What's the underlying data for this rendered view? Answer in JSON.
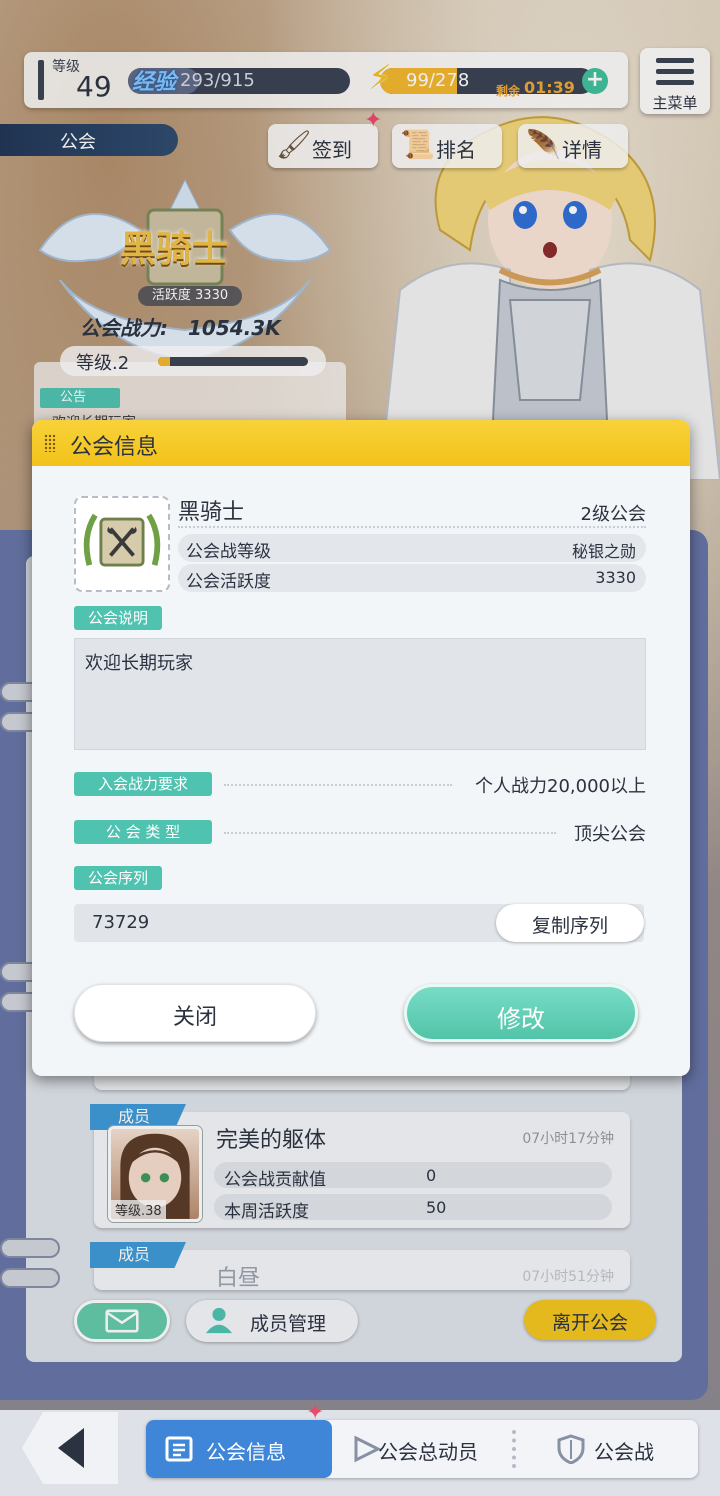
{
  "topbar": {
    "level_label": "等级",
    "level_value": "49",
    "exp_label": "经验",
    "exp_text": "293/915",
    "exp_progress": 0.32,
    "stamina_text": "99/278",
    "stamina_progress": 0.36,
    "remain_label": "剩余",
    "remain_time": "01:39",
    "menu_label": "主菜单"
  },
  "guild_header": {
    "tab_label": "公会",
    "signin_label": "签到",
    "rank_label": "排名",
    "detail_label": "详情",
    "name": "黑骑士",
    "activity_badge": "活跃度 3330",
    "power_label": "公会战力:",
    "power_value": "1054.3K",
    "level_label": "等级.2",
    "level_progress": 0.08,
    "notice_tag": "公告",
    "notice_text": "欢迎长期玩家"
  },
  "modal": {
    "title": "公会信息",
    "guild_name": "黑骑士",
    "guild_level": "2级公会",
    "rows": [
      {
        "key": "公会战等级",
        "value": "秘银之勋"
      },
      {
        "key": "公会活跃度",
        "value": "3330"
      }
    ],
    "desc_label": "公会说明",
    "desc_text": "欢迎长期玩家",
    "req_label": "入会战力要求",
    "req_value": "个人战力20,000以上",
    "type_label": "公 会 类 型",
    "type_value": "顶尖公会",
    "serial_label": "公会序列",
    "serial_value": "73729",
    "copy_label": "复制序列",
    "close_label": "关闭",
    "edit_label": "修改"
  },
  "members": [
    {
      "tag": "成员",
      "name": "完美的躯体",
      "time": "07小时17分钟",
      "level": "等级.38",
      "contrib_label": "公会战贡献值",
      "contrib_value": "0",
      "weekly_label": "本周活跃度",
      "weekly_value": "50"
    },
    {
      "tag": "成员",
      "name": "白昼",
      "time": "07小时51分钟"
    }
  ],
  "list_actions": {
    "member_mgmt_label": "成员管理",
    "leave_label": "离开公会"
  },
  "nav": {
    "tabs": [
      {
        "label": "公会信息",
        "active": true
      },
      {
        "label": "公会总动员",
        "active": false
      },
      {
        "label": "公会战",
        "active": false
      }
    ]
  },
  "colors": {
    "accent_teal": "#4fc3b0",
    "accent_yellow": "#f5c61c",
    "nav_active": "#3f86d8"
  }
}
